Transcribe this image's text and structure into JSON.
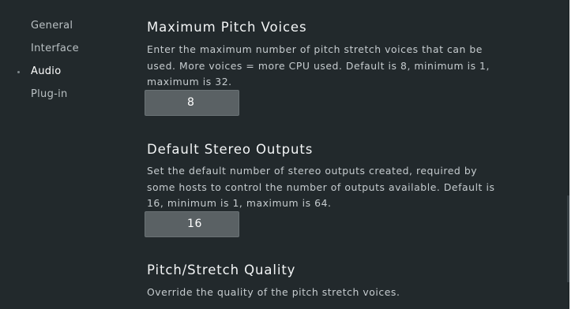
{
  "sidebar": {
    "items": [
      {
        "label": "General",
        "active": false
      },
      {
        "label": "Interface",
        "active": false
      },
      {
        "label": "Audio",
        "active": true
      },
      {
        "label": "Plug-in",
        "active": false
      }
    ]
  },
  "sections": [
    {
      "title": "Maximum Pitch Voices",
      "description_lines": [
        "Enter the maximum number of pitch stretch voices that can be",
        "used. More voices = more CPU used. Default is 8, minimum is 1,",
        "maximum is 32."
      ],
      "value": "8"
    },
    {
      "title": "Default Stereo Outputs",
      "description_lines": [
        "Set the default number of stereo outputs created, required by",
        "some hosts to control the number of outputs available. Default is",
        "16, minimum is 1, maximum is 64."
      ],
      "value": "16"
    },
    {
      "title": "Pitch/Stretch Quality",
      "description_lines": [
        "Override the quality of the pitch stretch voices."
      ]
    }
  ],
  "colors": {
    "background": "#22292c",
    "field_background": "#5a6164",
    "text_primary": "#f3f5f6",
    "text_secondary": "#c6cccf",
    "nav_inactive": "#b9c0c3",
    "nav_active": "#ffffff"
  }
}
